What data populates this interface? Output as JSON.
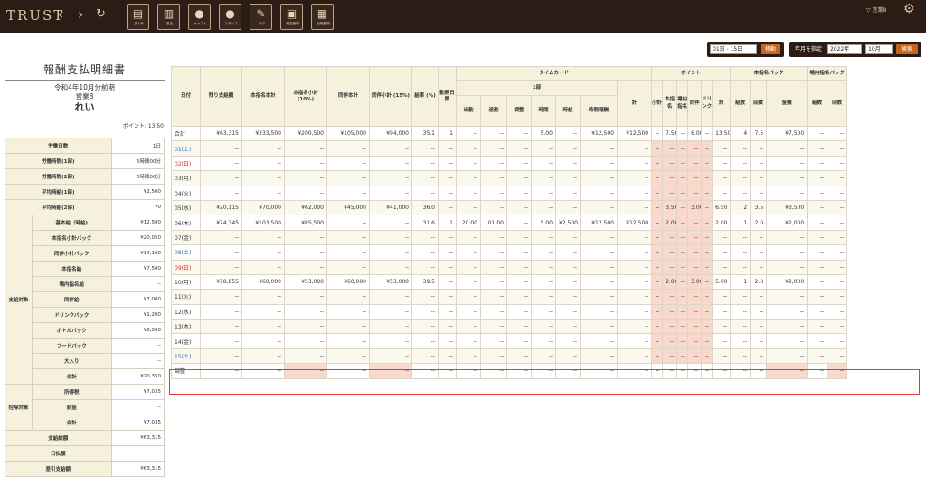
{
  "app": {
    "logo": "TRUST",
    "nav_back": "‹",
    "nav_fwd": "›",
    "refresh": "↻",
    "user": "▽ 営業8"
  },
  "toolbar": [
    {
      "icon": "clipboard-icon",
      "glyph": "▤",
      "label": "まとめ"
    },
    {
      "icon": "chart-icon",
      "glyph": "▥",
      "label": "収支"
    },
    {
      "icon": "cast-icon",
      "glyph": "●",
      "label": "キャスト"
    },
    {
      "icon": "staff-icon",
      "glyph": "●",
      "label": "スタッフ"
    },
    {
      "icon": "tag-icon",
      "glyph": "✎",
      "label": "タグ"
    },
    {
      "icon": "cash-icon",
      "glyph": "▣",
      "label": "現金管理"
    },
    {
      "icon": "report-icon",
      "glyph": "▦",
      "label": "日報登録"
    }
  ],
  "period": {
    "select": "01日 - 15日",
    "button": "移動",
    "label": "年月を指定",
    "year": "2022年",
    "month": "10月",
    "search": "検索"
  },
  "left": {
    "title": "報酬支払明細書",
    "period": "令和4年10月分前期",
    "store": "営業8",
    "name": "れい",
    "points": "ポイント: 13.50",
    "rows": [
      {
        "label": "労働日数",
        "value": "1日"
      },
      {
        "label": "労働時間(1部)",
        "value": "5時間00分"
      },
      {
        "label": "労働時間(2部)",
        "value": "0時間00分"
      },
      {
        "label": "平均時給(1部)",
        "value": "¥2,500"
      },
      {
        "label": "平均時給(2部)",
        "value": "¥0"
      }
    ],
    "group1": "支給対象",
    "pay": [
      {
        "label": "基本給（時給)",
        "value": "¥12,500"
      },
      {
        "label": "本指名小計バック",
        "value": "¥20,050"
      },
      {
        "label": "同伴小計バック",
        "value": "¥14,100"
      },
      {
        "label": "本指名給",
        "value": "¥7,500"
      },
      {
        "label": "場内指名給",
        "value": "--"
      },
      {
        "label": "同伴給",
        "value": "¥7,000"
      },
      {
        "label": "ドリンクバック",
        "value": "¥1,200"
      },
      {
        "label": "ボトルバック",
        "value": "¥8,000"
      },
      {
        "label": "フードバック",
        "value": "--"
      },
      {
        "label": "大入り",
        "value": "--"
      },
      {
        "label": "合計",
        "value": "¥70,350"
      }
    ],
    "group2": "控除対象",
    "ded": [
      {
        "label": "所得税",
        "value": "¥7,035"
      },
      {
        "label": "罰金",
        "value": "--"
      },
      {
        "label": "合計",
        "value": "¥7,035"
      }
    ],
    "totals": [
      {
        "label": "支給総額",
        "value": "¥63,315"
      },
      {
        "label": "日払額",
        "value": "--"
      },
      {
        "label": "差引支給額",
        "value": "¥63,315"
      }
    ]
  },
  "table": {
    "headers": {
      "date": "日付",
      "remain": "残り支給額",
      "honshimei": "本指名本計",
      "honshimei_sub": "本指名小計 (10%)",
      "douhan": "同伴本計",
      "douhan_sub": "同伴小計 (15%)",
      "rate": "給率 (%)",
      "days": "勤務日数",
      "timecard": "タイムカード",
      "part1": "1部",
      "in": "出勤",
      "out": "退勤",
      "adjust": "調整",
      "hours": "時間",
      "wage": "時給",
      "pay": "時間報酬",
      "total": "計",
      "point": "ポイント",
      "p_sub": "小計",
      "p_hon": "本指名",
      "p_jonai": "場内指名",
      "p_douhan": "同伴",
      "p_drink": "ドリンク",
      "p_total": "計",
      "hon_back": "本指名バック",
      "jonai_back": "場内指名バック",
      "cnt": "組数",
      "times": "回数",
      "amount": "金額"
    },
    "total_row": [
      "合計",
      "¥63,315",
      "¥233,500",
      "¥200,500",
      "¥105,000",
      "¥94,000",
      "35.1",
      "1",
      "--",
      "--",
      "--",
      "5.00",
      "--",
      "¥12,500",
      "¥12,500",
      "--",
      "7.50",
      "--",
      "6.00",
      "--",
      "13.50",
      "4",
      "7.5",
      "¥7,500",
      "--",
      "--"
    ],
    "rows": [
      [
        "01(土)",
        "--",
        "--",
        "--",
        "--",
        "--",
        "--",
        "--",
        "--",
        "--",
        "--",
        "--",
        "--",
        "--",
        "--",
        "--",
        "--",
        "--",
        "--",
        "--",
        "--",
        "--",
        "--",
        "--",
        "--",
        "--"
      ],
      [
        "02(日)",
        "--",
        "--",
        "--",
        "--",
        "--",
        "--",
        "--",
        "--",
        "--",
        "--",
        "--",
        "--",
        "--",
        "--",
        "--",
        "--",
        "--",
        "--",
        "--",
        "--",
        "--",
        "--",
        "--",
        "--",
        "--"
      ],
      [
        "03(月)",
        "--",
        "--",
        "--",
        "--",
        "--",
        "--",
        "--",
        "--",
        "--",
        "--",
        "--",
        "--",
        "--",
        "--",
        "--",
        "--",
        "--",
        "--",
        "--",
        "--",
        "--",
        "--",
        "--",
        "--",
        "--"
      ],
      [
        "04(火)",
        "--",
        "--",
        "--",
        "--",
        "--",
        "--",
        "--",
        "--",
        "--",
        "--",
        "--",
        "--",
        "--",
        "--",
        "--",
        "--",
        "--",
        "--",
        "--",
        "--",
        "--",
        "--",
        "--",
        "--",
        "--"
      ],
      [
        "05(水)",
        "¥20,115",
        "¥70,000",
        "¥62,000",
        "¥45,000",
        "¥41,000",
        "36.0",
        "--",
        "--",
        "--",
        "--",
        "--",
        "--",
        "--",
        "--",
        "--",
        "3.50",
        "--",
        "3.00",
        "--",
        "6.50",
        "2",
        "3.5",
        "¥3,500",
        "--",
        "--"
      ],
      [
        "06(木)",
        "¥24,345",
        "¥103,500",
        "¥85,500",
        "--",
        "--",
        "31.6",
        "1",
        "20:00",
        "01:00",
        "--",
        "5.00",
        "¥2,500",
        "¥12,500",
        "¥12,500",
        "--",
        "2.00",
        "--",
        "--",
        "--",
        "2.00",
        "1",
        "2.0",
        "¥2,000",
        "--",
        "--"
      ],
      [
        "07(金)",
        "--",
        "--",
        "--",
        "--",
        "--",
        "--",
        "--",
        "--",
        "--",
        "--",
        "--",
        "--",
        "--",
        "--",
        "--",
        "--",
        "--",
        "--",
        "--",
        "--",
        "--",
        "--",
        "--",
        "--",
        "--"
      ],
      [
        "08(土)",
        "--",
        "--",
        "--",
        "--",
        "--",
        "--",
        "--",
        "--",
        "--",
        "--",
        "--",
        "--",
        "--",
        "--",
        "--",
        "--",
        "--",
        "--",
        "--",
        "--",
        "--",
        "--",
        "--",
        "--",
        "--"
      ],
      [
        "09(日)",
        "--",
        "--",
        "--",
        "--",
        "--",
        "--",
        "--",
        "--",
        "--",
        "--",
        "--",
        "--",
        "--",
        "--",
        "--",
        "--",
        "--",
        "--",
        "--",
        "--",
        "--",
        "--",
        "--",
        "--",
        "--"
      ],
      [
        "10(月)",
        "¥18,855",
        "¥60,000",
        "¥53,000",
        "¥60,000",
        "¥53,000",
        "39.5",
        "--",
        "--",
        "--",
        "--",
        "--",
        "--",
        "--",
        "--",
        "--",
        "2.00",
        "--",
        "3.00",
        "--",
        "5.00",
        "1",
        "2.0",
        "¥2,000",
        "--",
        "--"
      ],
      [
        "11(火)",
        "--",
        "--",
        "--",
        "--",
        "--",
        "--",
        "--",
        "--",
        "--",
        "--",
        "--",
        "--",
        "--",
        "--",
        "--",
        "--",
        "--",
        "--",
        "--",
        "--",
        "--",
        "--",
        "--",
        "--",
        "--"
      ],
      [
        "12(水)",
        "--",
        "--",
        "--",
        "--",
        "--",
        "--",
        "--",
        "--",
        "--",
        "--",
        "--",
        "--",
        "--",
        "--",
        "--",
        "--",
        "--",
        "--",
        "--",
        "--",
        "--",
        "--",
        "--",
        "--",
        "--"
      ],
      [
        "13(木)",
        "--",
        "--",
        "--",
        "--",
        "--",
        "--",
        "--",
        "--",
        "--",
        "--",
        "--",
        "--",
        "--",
        "--",
        "--",
        "--",
        "--",
        "--",
        "--",
        "--",
        "--",
        "--",
        "--",
        "--",
        "--"
      ],
      [
        "14(金)",
        "--",
        "--",
        "--",
        "--",
        "--",
        "--",
        "--",
        "--",
        "--",
        "--",
        "--",
        "--",
        "--",
        "--",
        "--",
        "--",
        "--",
        "--",
        "--",
        "--",
        "--",
        "--",
        "--",
        "--",
        "--"
      ],
      [
        "15(土)",
        "--",
        "--",
        "--",
        "--",
        "--",
        "--",
        "--",
        "--",
        "--",
        "--",
        "--",
        "--",
        "--",
        "--",
        "--",
        "--",
        "--",
        "--",
        "--",
        "--",
        "--",
        "--",
        "--",
        "--",
        "--"
      ]
    ],
    "adjust_row": [
      "調整",
      "--",
      "--",
      "--",
      "--",
      "--",
      "--",
      "--",
      "--",
      "--",
      "--",
      "--",
      "--",
      "--",
      "--",
      "--",
      "--",
      "--",
      "--",
      "--",
      "--",
      "--",
      "--",
      "--",
      "--",
      "--"
    ]
  }
}
